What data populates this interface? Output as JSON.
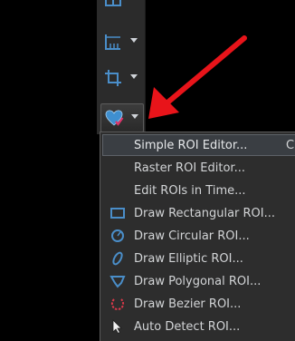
{
  "toolbar": {
    "buttons": [
      {
        "icon": "grid-icon"
      },
      {
        "icon": "measure-icon"
      },
      {
        "icon": "crop-icon"
      },
      {
        "icon": "roi-heart-icon"
      }
    ]
  },
  "menu": {
    "items": [
      {
        "label": "Simple ROI Editor...",
        "shortcut": "C"
      },
      {
        "label": "Raster ROI Editor..."
      },
      {
        "label": "Edit ROIs in Time..."
      },
      {
        "label": "Draw Rectangular ROI..."
      },
      {
        "label": "Draw Circular ROI..."
      },
      {
        "label": "Draw Elliptic ROI..."
      },
      {
        "label": "Draw Polygonal ROI..."
      },
      {
        "label": "Draw Bezier ROI..."
      },
      {
        "label": "Auto Detect ROI..."
      }
    ]
  },
  "colors": {
    "annotation_arrow": "#e8141a",
    "menu_background": "#2d2d2d",
    "toolbar_background": "#2b2b2b",
    "icon_blue": "#4a8ec9"
  }
}
